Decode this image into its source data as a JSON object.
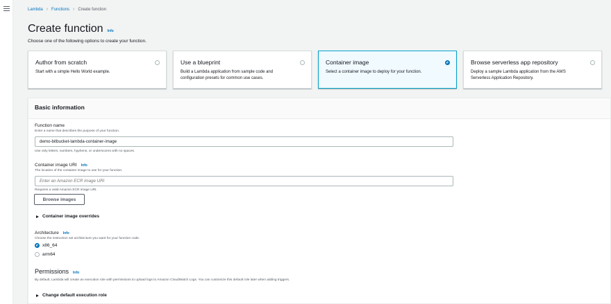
{
  "breadcrumb": {
    "items": [
      "Lambda",
      "Functions"
    ],
    "current": "Create function"
  },
  "page": {
    "title": "Create function",
    "info": "Info",
    "description": "Choose one of the following options to create your function."
  },
  "options": [
    {
      "title": "Author from scratch",
      "desc_line1": "Start with a simple Hello World example.",
      "desc_line2": "",
      "selected": false
    },
    {
      "title": "Use a blueprint",
      "desc_line1": "Build a Lambda application from sample code and",
      "desc_line2": "configuration presets for common use cases.",
      "selected": false
    },
    {
      "title": "Container image",
      "desc_line1": "Select a container image to deploy for your function.",
      "desc_line2": "",
      "selected": true
    },
    {
      "title": "Browse serverless app repository",
      "desc_line1": "Deploy a sample Lambda application from the AWS",
      "desc_line2": "Serverless Application Repository.",
      "selected": false
    }
  ],
  "basic_info": {
    "header": "Basic information",
    "function_name": {
      "label": "Function name",
      "description": "Enter a name that describes the purpose of your function.",
      "value": "demo-bitbucket-lambda-container-image",
      "constraint": "Use only letters, numbers, hyphens, or underscores with no spaces."
    },
    "image_uri": {
      "label": "Container image URI",
      "info": "Info",
      "description": "The location of the container image to use for your function.",
      "placeholder": "Enter an Amazon ECR image URI",
      "constraint": "Requires a valid Amazon ECR image URI.",
      "browse_button": "Browse images"
    },
    "overrides_label": "Container image overrides",
    "architecture": {
      "label": "Architecture",
      "info": "Info",
      "description": "Choose the instruction set architecture you want for your function code.",
      "options": [
        "x86_64",
        "arm64"
      ],
      "selected": "x86_64"
    },
    "permissions": {
      "title": "Permissions",
      "info": "Info",
      "description": "By default, Lambda will create an execution role with permissions to upload logs to Amazon CloudWatch Logs. You can customize this default role later when adding triggers.",
      "role_expander": "Change default execution role"
    }
  },
  "colors": {
    "link": "#0073bb",
    "selected_bg": "#f1faff",
    "selected_border": "#00a1c9"
  }
}
